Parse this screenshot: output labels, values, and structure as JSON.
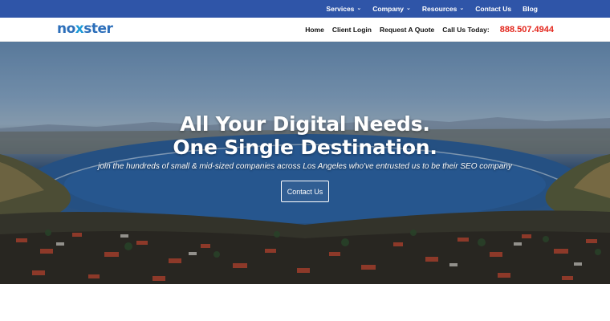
{
  "topbar": {
    "items": [
      {
        "label": "Services",
        "has_dropdown": true
      },
      {
        "label": "Company",
        "has_dropdown": true
      },
      {
        "label": "Resources",
        "has_dropdown": true
      },
      {
        "label": "Contact Us",
        "has_dropdown": false
      },
      {
        "label": "Blog",
        "has_dropdown": false
      }
    ],
    "chevron_glyph": "⌄"
  },
  "header": {
    "logo_text_pre": "no",
    "logo_text_x": "x",
    "logo_text_post": "ster",
    "nav": [
      "Home",
      "Client Login",
      "Request A Quote"
    ],
    "call_label": "Call Us Today:",
    "phone": "888.507.4944"
  },
  "hero": {
    "headline_line1": "All Your Digital Needs.",
    "headline_line2": "One Single Destination.",
    "subline": "join the hundreds of small & mid-sized companies across Los Angeles who've entrusted us to be their SEO company",
    "cta_label": "Contact Us"
  },
  "colors": {
    "topbar": "#2f55a8",
    "logo": "#2d6fba",
    "phone": "#e3261c"
  }
}
